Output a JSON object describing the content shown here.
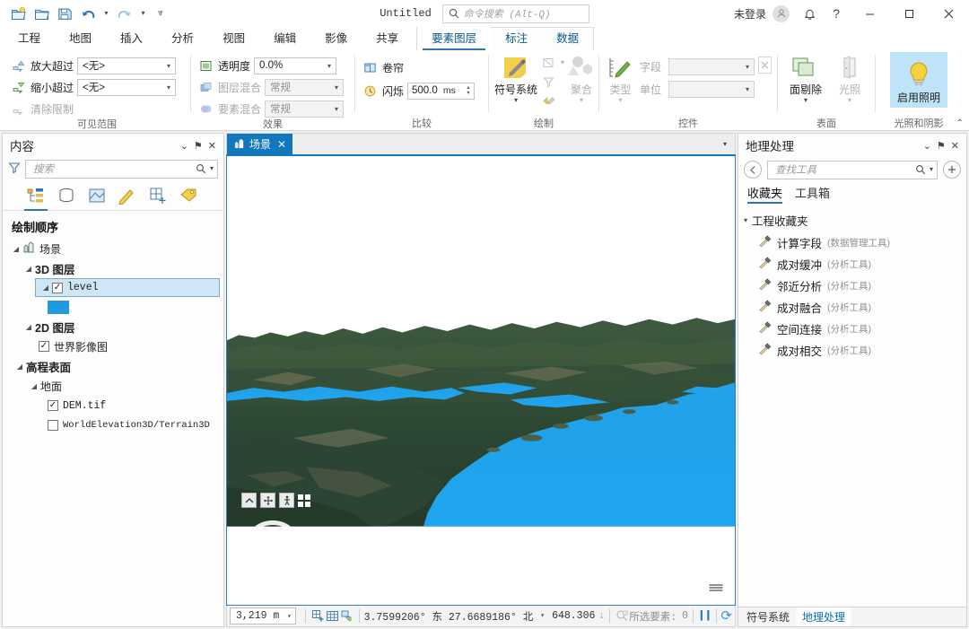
{
  "titlebar": {
    "quick_access": [
      {
        "name": "new-project-icon",
        "label": "新建"
      },
      {
        "name": "open-project-icon",
        "label": "打开"
      },
      {
        "name": "save-project-icon",
        "label": "保存"
      },
      {
        "name": "undo-icon",
        "label": "撤销"
      },
      {
        "name": "redo-icon",
        "label": "重做"
      },
      {
        "name": "customize-qat-icon",
        "label": "自定义"
      }
    ],
    "document_title": "Untitled",
    "command_search_placeholder": "命令搜索 (Alt-Q)",
    "sign_in": "未登录",
    "minimize": "–",
    "maximize": "☐",
    "close": "✕",
    "help": "?"
  },
  "ribbon": {
    "tabs": [
      "工程",
      "地图",
      "插入",
      "分析",
      "视图",
      "编辑",
      "影像",
      "共享"
    ],
    "contextual_tabs": [
      "要素图层",
      "标注",
      "数据"
    ],
    "active_tab": "要素图层",
    "collapse_glyph": "⌃",
    "groups": [
      {
        "name": "visible-range",
        "label": "可见范围",
        "rows": [
          {
            "label": "放大超过",
            "value": "<无>",
            "icon": "zoom-in-beyond-icon",
            "enabled": true
          },
          {
            "label": "缩小超过",
            "value": "<无>",
            "icon": "zoom-out-beyond-icon",
            "enabled": true
          },
          {
            "label": "清除限制",
            "value": "",
            "icon": "clear-limits-icon",
            "enabled": false
          }
        ]
      },
      {
        "name": "effects",
        "label": "效果",
        "rows": [
          {
            "label": "透明度",
            "value": "0.0%",
            "icon": "transparency-icon",
            "enabled": true
          },
          {
            "label": "图层混合",
            "value": "常规",
            "icon": "layer-blend-icon",
            "enabled": false
          },
          {
            "label": "要素混合",
            "value": "常规",
            "icon": "feature-blend-icon",
            "enabled": false
          }
        ]
      },
      {
        "name": "compare",
        "label": "比较",
        "swipe_label": "卷帘",
        "flicker_label": "闪烁",
        "flicker_value": "500.0",
        "flicker_units": "ms"
      },
      {
        "name": "drawing",
        "label": "绘制",
        "symbology_label": "符号系统",
        "aggregation_label": "聚合",
        "buttons": [
          "display-filters-icon",
          "symbology-import-icon"
        ]
      },
      {
        "name": "widget",
        "label": "控件",
        "type_label": "类型",
        "field_label": "字段",
        "field_value": "",
        "unit_label": "单位",
        "unit_value": "",
        "expression_icon": "expression-builder-icon"
      },
      {
        "name": "surface",
        "label": "表面",
        "cull_label": "面剔除",
        "lighting_label": "光照"
      },
      {
        "name": "illumination-shadow",
        "label": "光照和阴影",
        "enable_lighting_label": "启用照明",
        "enabled_toggle": true
      }
    ]
  },
  "contents_panel": {
    "title": "内容",
    "search_placeholder": "搜索",
    "collapse_glyph": "⌄",
    "pin_glyph": "⚑",
    "close_glyph": "✕",
    "tab_icons": [
      "list-by-drawing-order-icon",
      "list-by-data-source-icon",
      "list-by-selection-icon",
      "list-by-editing-icon",
      "list-by-snapping-icon",
      "list-by-labeling-icon"
    ],
    "active_tab_index": 0,
    "section_title": "绘制顺序",
    "tree": [
      {
        "label": "场景",
        "indent": 0,
        "twisty": "◢",
        "checkbox": "none",
        "icon": "scene-icon",
        "bold": false
      },
      {
        "label": "3D 图层",
        "indent": 1,
        "twisty": "◢",
        "checkbox": "none",
        "icon": "",
        "bold": true
      },
      {
        "label": "level",
        "indent": 2,
        "twisty": "◢",
        "checkbox": "checked",
        "icon": "",
        "bold": false,
        "selected": true,
        "mono": true
      },
      {
        "label": "",
        "indent": 3,
        "twisty": "none",
        "checkbox": "none",
        "icon": "",
        "swatch": "#1f9ae0"
      },
      {
        "label": "2D 图层",
        "indent": 1,
        "twisty": "◢",
        "checkbox": "none",
        "icon": "",
        "bold": true
      },
      {
        "label": "世界影像图",
        "indent": 2,
        "twisty": "none",
        "checkbox": "checked",
        "icon": "",
        "bold": false
      },
      {
        "label": "高程表面",
        "indent": 1,
        "twisty": "◢",
        "checkbox": "none",
        "icon": "",
        "bold": true
      },
      {
        "label": "地面",
        "indent": 2,
        "twisty": "◢",
        "checkbox": "none",
        "icon": "",
        "bold": false
      },
      {
        "label": "DEM.tif",
        "indent": 3,
        "twisty": "none",
        "checkbox": "checked",
        "icon": "",
        "bold": false,
        "mono": true
      },
      {
        "label": "WorldElevation3D/Terrain3D",
        "indent": 3,
        "twisty": "none",
        "checkbox": "unchecked",
        "icon": "",
        "bold": false,
        "mono": true
      }
    ]
  },
  "map": {
    "view_tab_label": "场景",
    "view_tab_close": "✕",
    "nav_buttons": [
      "look-around-icon",
      "pan-icon",
      "walk-icon",
      "full-control-icon"
    ],
    "navigator_name": "navigator-compass",
    "logo_name": "esri-logo"
  },
  "statusbar": {
    "scale": "3,219 m",
    "icons": [
      "add-grid-icon",
      "grid-icon",
      "selection-icon"
    ],
    "coordinates": "3.7599206° 东  27.6689186° 北",
    "elevation": "648.306",
    "elevation_suffix": "↓",
    "selected_label": "所选要素:",
    "selected_count": "0",
    "pause_glyph": "❙❙",
    "refresh_glyph": "⟳"
  },
  "geoprocessing_panel": {
    "title": "地理处理",
    "collapse_glyph": "⌄",
    "pin_glyph": "⚑",
    "close_glyph": "✕",
    "back_glyph": "←",
    "add_glyph": "+",
    "search_placeholder": "查找工具",
    "tabs": [
      "收藏夹",
      "工具箱"
    ],
    "active_tab": "收藏夹",
    "group_label": "工程收藏夹",
    "tools": [
      {
        "name": "计算字段",
        "category": "(数据管理工具)"
      },
      {
        "name": "成对缓冲",
        "category": "(分析工具)"
      },
      {
        "name": "邻近分析",
        "category": "(分析工具)"
      },
      {
        "name": "成对融合",
        "category": "(分析工具)"
      },
      {
        "name": "空间连接",
        "category": "(分析工具)"
      },
      {
        "name": "成对相交",
        "category": "(分析工具)"
      }
    ]
  },
  "dock_tabs": {
    "items": [
      "符号系统",
      "地理处理"
    ],
    "active": "地理处理"
  },
  "colors": {
    "accent": "#2e75b6",
    "tab_blue": "#1178bd",
    "selection": "#cfe6f5",
    "layer_swatch": "#1f9ae0",
    "water": "#22a3e8",
    "terrain_dark": "#2b4230",
    "highlight_yellow": "#e8c54a"
  }
}
